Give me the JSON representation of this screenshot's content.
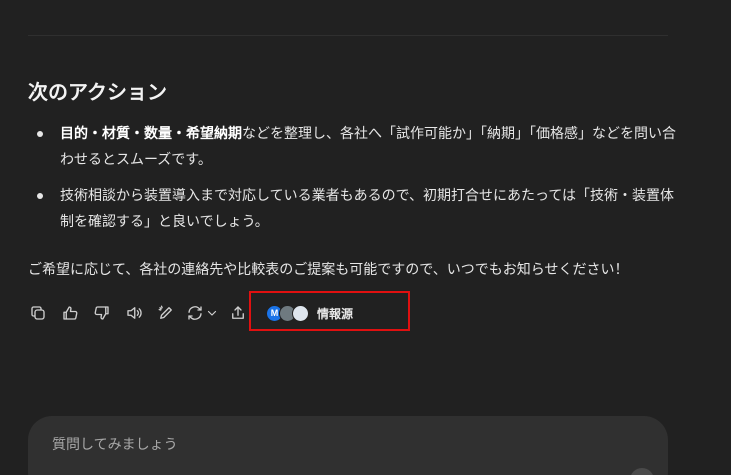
{
  "section": {
    "heading": "次のアクション",
    "bullets": [
      {
        "bold": "目的・材質・数量・希望納期",
        "text": "などを整理し、各社へ「試作可能か」「納期」「価格感」などを問い合わせるとスムーズです。"
      },
      {
        "bold": "",
        "text": "技術相談から装置導入まで対応している業者もあるので、初期打合せにあたっては「技術・装置体制を確認する」と良いでしょう。"
      }
    ],
    "closing": "ご希望に応じて、各社の連絡先や比較表のご提案も可能ですので、いつでもお知らせください！"
  },
  "actions": {
    "icons": [
      "copy-icon",
      "thumbs-up-icon",
      "thumbs-down-icon",
      "speaker-icon",
      "edit-icon",
      "regenerate-icon",
      "share-icon"
    ],
    "sources_label": "情報源",
    "source_favicons": [
      "M",
      "",
      ""
    ]
  },
  "composer": {
    "placeholder": "質問してみましょう"
  },
  "colors": {
    "background": "#212121",
    "composer_bg": "#303030",
    "highlight": "#e01010"
  }
}
